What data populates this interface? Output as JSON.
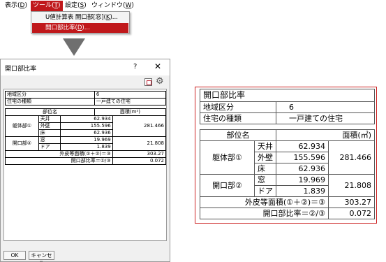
{
  "menubar": {
    "items": [
      {
        "label": "表示(",
        "mn": "D",
        "tail": ")"
      },
      {
        "label": "ツール(",
        "mn": "T",
        "tail": ")"
      },
      {
        "label": "設定(",
        "mn": "S",
        "tail": ")"
      },
      {
        "label": "ウィンドウ(",
        "mn": "W",
        "tail": ")"
      }
    ]
  },
  "dropdown": {
    "items": [
      {
        "label": "U値計算表 開口部[窓](",
        "mn": "K",
        "tail": ")..."
      },
      {
        "label": "開口部比率(",
        "mn": "D",
        "tail": ")..."
      }
    ]
  },
  "dialog": {
    "title": "開口部比率",
    "help_glyph": "?",
    "close_glyph": "✕",
    "ok_label": "OK",
    "cancel_label": "キャンセル",
    "table": {
      "region_label": "地域区分",
      "region_value": "6",
      "house_type_label": "住宅の種類",
      "house_type_value": "一戸建ての住宅",
      "part_name_header": "部位名",
      "area_header": "面積(m²)",
      "body_label": "躯体部①",
      "ceiling_label": "天井",
      "ceiling_value": "62.934",
      "wall_label": "外壁",
      "wall_value": "155.596",
      "floor_label": "床",
      "floor_value": "62.936",
      "body_total": "281.466",
      "opening_label": "開口部②",
      "window_label": "窓",
      "window_value": "19.969",
      "door_label": "ドア",
      "door_value": "1.839",
      "opening_total": "21.808",
      "envelope_label": "外皮等面積(①＋②)＝③",
      "envelope_value": "303.27",
      "ratio_label": "開口部比率＝②/③",
      "ratio_value": "0.072"
    }
  },
  "form": {
    "title": "開口部比率",
    "region_label": "地域区分",
    "region_value": "6",
    "house_type_label": "住宅の種類",
    "house_type_value": "一戸建ての住宅",
    "part_name_header": "部位名",
    "area_header": "面積(㎡)",
    "body_label": "躯体部①",
    "ceiling_label": "天井",
    "ceiling_value": "62.934",
    "wall_label": "外壁",
    "wall_value": "155.596",
    "floor_label": "床",
    "floor_value": "62.936",
    "body_total": "281.466",
    "opening_label": "開口部②",
    "window_label": "窓",
    "window_value": "19.969",
    "door_label": "ドア",
    "door_value": "1.839",
    "opening_total": "21.808",
    "envelope_label": "外皮等面積(①＋②)＝③",
    "envelope_value": "303.27",
    "ratio_label": "開口部比率＝②/③",
    "ratio_value": "0.072"
  },
  "colors": {
    "menu_highlight": "#c0181b",
    "form_border": "#cc2222"
  },
  "icons": {
    "arrow": "arrow-down-icon",
    "tool_a": "sheet-view-icon",
    "tool_b": "gear-icon"
  }
}
